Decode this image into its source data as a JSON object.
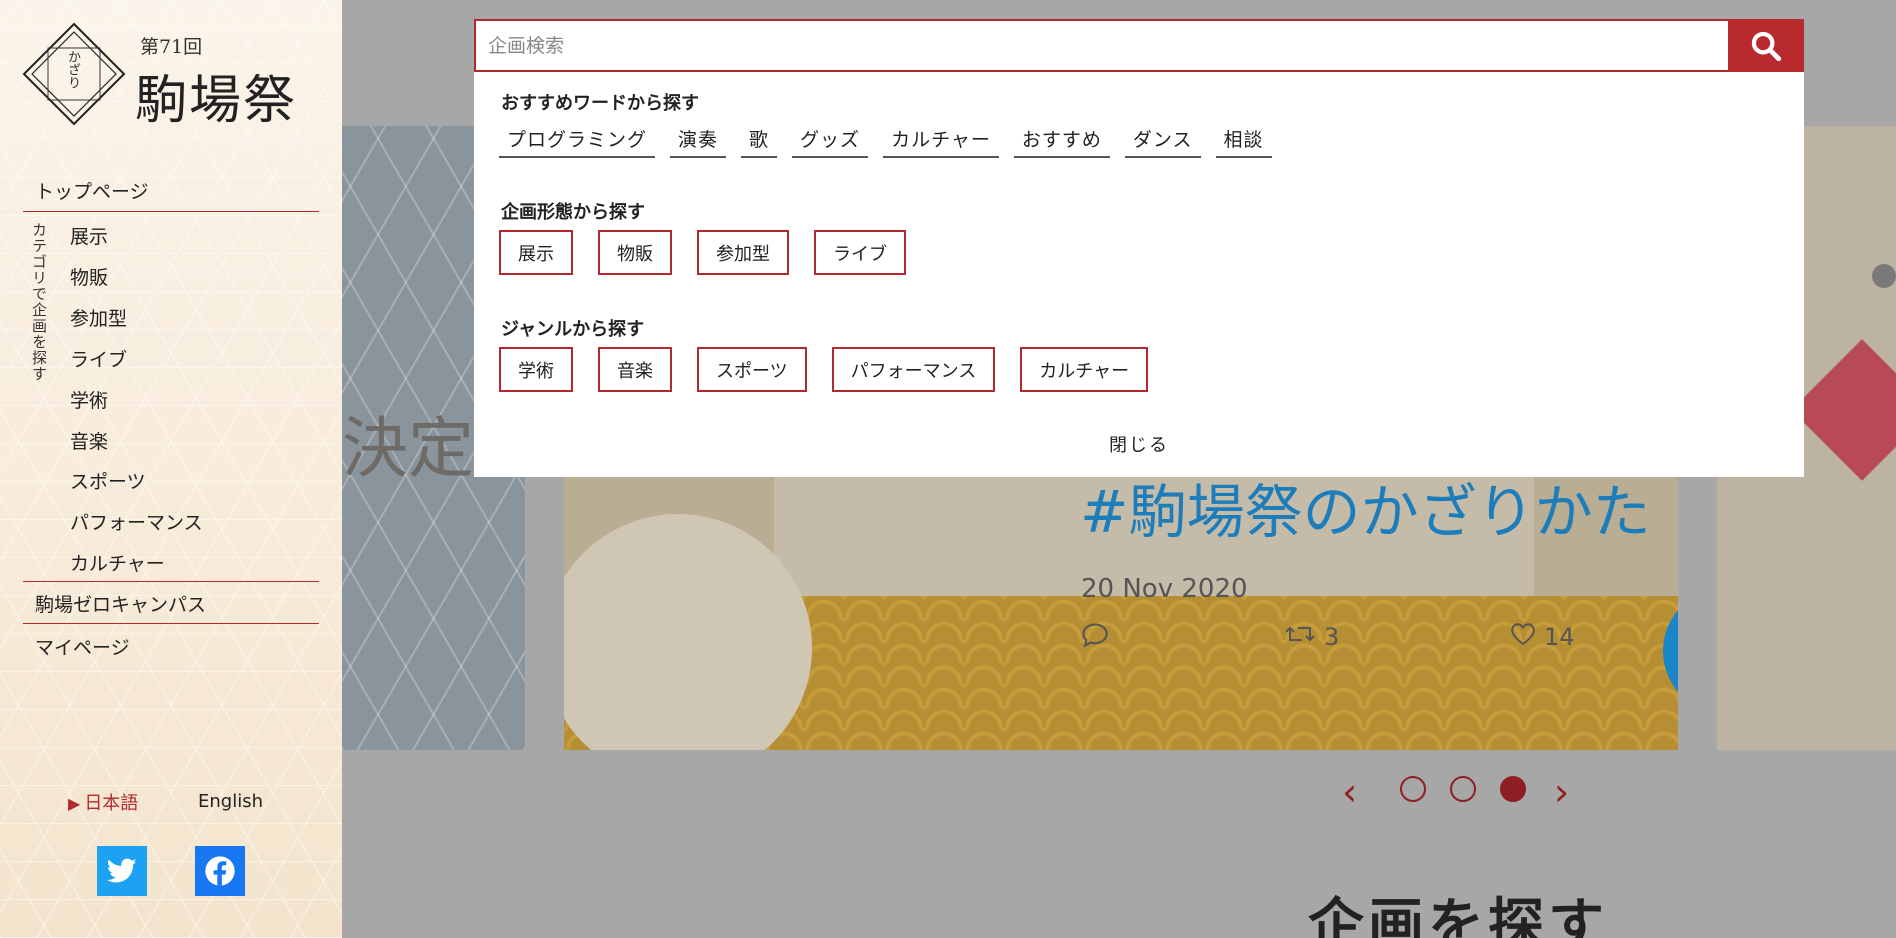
{
  "sidebar": {
    "logo": {
      "edition": "第71回",
      "title": "駒場祭",
      "kana": "かざり"
    },
    "nav": {
      "top_page": "トップページ",
      "category_caption": "カテゴリで企画を探す",
      "categories": [
        "展示",
        "物販",
        "参加型",
        "ライブ",
        "学術",
        "音楽",
        "スポーツ",
        "パフォーマンス",
        "カルチャー"
      ],
      "zero_campus": "駒場ゼロキャンパス",
      "my_page": "マイページ"
    },
    "lang": {
      "ja": "日本語",
      "en": "English"
    },
    "social": {
      "twitter_icon": "twitter-icon",
      "facebook_icon": "facebook-icon"
    }
  },
  "background": {
    "slide_left_text": "決定",
    "tweet": {
      "hashtag": "#駒場祭のかざりかた",
      "date": "20 Nov 2020",
      "retweets": "3",
      "likes": "14"
    },
    "carousel": {
      "prev": "‹",
      "next": "›",
      "dots": 3,
      "active_dot": 3
    },
    "section_heading": "企画を探す"
  },
  "search": {
    "placeholder": "企画検索",
    "value": "",
    "button_icon": "search-icon",
    "recommended": {
      "title": "おすすめワードから探す",
      "words": [
        "プログラミング",
        "演奏",
        "歌",
        "グッズ",
        "カルチャー",
        "おすすめ",
        "ダンス",
        "相談"
      ]
    },
    "format": {
      "title": "企画形態から探す",
      "chips": [
        "展示",
        "物販",
        "参加型",
        "ライブ"
      ]
    },
    "genre": {
      "title": "ジャンルから探す",
      "chips": [
        "学術",
        "音楽",
        "スポーツ",
        "パフォーマンス",
        "カルチャー"
      ]
    },
    "close_label": "閉じる"
  },
  "colors": {
    "accent": "#b22a2e",
    "twitter": "#1da1f2",
    "facebook": "#1877f2"
  }
}
